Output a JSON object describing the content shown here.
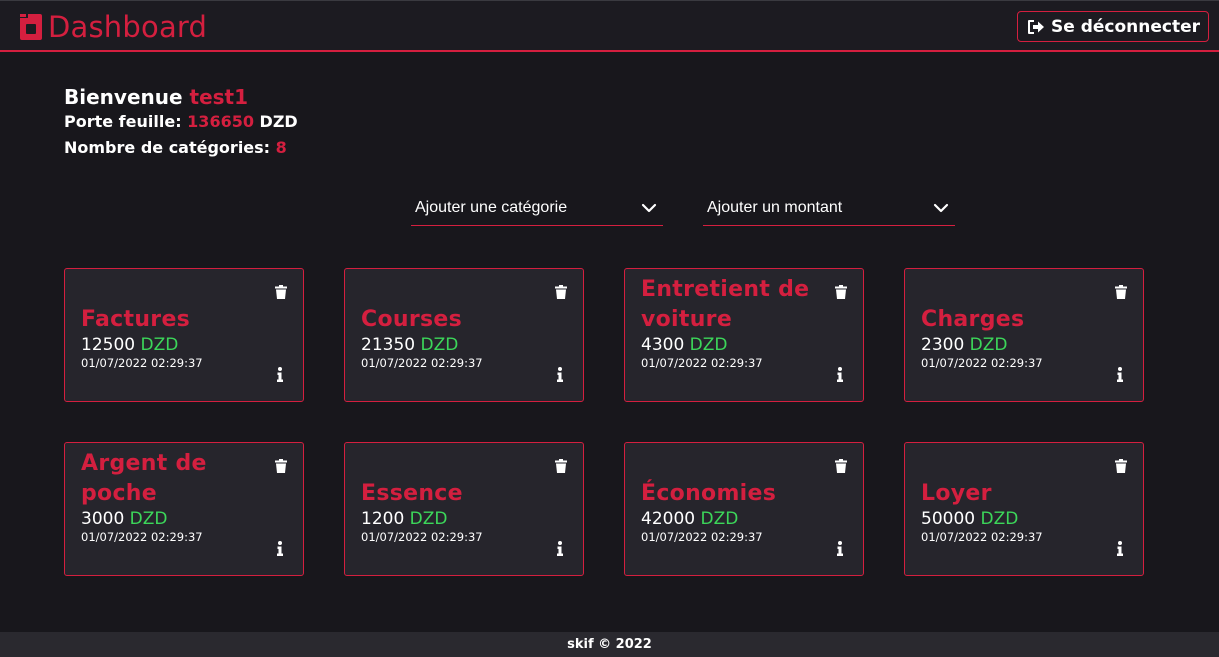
{
  "header": {
    "title": "Dashboard",
    "logout_label": "Se déconnecter",
    "logo_icon": "dashboard-logo-icon",
    "logout_icon": "sign-out-icon"
  },
  "welcome": {
    "greeting": "Bienvenue",
    "username": "test1",
    "wallet_label": "Porte feuille:",
    "wallet_value": "136650",
    "wallet_currency": "DZD",
    "categories_label": "Nombre de catégories:",
    "categories_count": "8"
  },
  "actions": {
    "add_category": "Ajouter une catégorie",
    "add_amount": "Ajouter un montant"
  },
  "cards": [
    {
      "name": "Factures",
      "amount": "12500",
      "currency": "DZD",
      "date": "01/07/2022 02:29:37"
    },
    {
      "name": "Courses",
      "amount": "21350",
      "currency": "DZD",
      "date": "01/07/2022 02:29:37"
    },
    {
      "name": "Entretient de voiture",
      "amount": "4300",
      "currency": "DZD",
      "date": "01/07/2022 02:29:37"
    },
    {
      "name": "Charges",
      "amount": "2300",
      "currency": "DZD",
      "date": "01/07/2022 02:29:37"
    },
    {
      "name": "Argent de poche",
      "amount": "3000",
      "currency": "DZD",
      "date": "01/07/2022 02:29:37"
    },
    {
      "name": "Essence",
      "amount": "1200",
      "currency": "DZD",
      "date": "01/07/2022 02:29:37"
    },
    {
      "name": "Économies",
      "amount": "42000",
      "currency": "DZD",
      "date": "01/07/2022 02:29:37"
    },
    {
      "name": "Loyer",
      "amount": "50000",
      "currency": "DZD",
      "date": "01/07/2022 02:29:37"
    }
  ],
  "footer": {
    "text": "skif © 2022"
  },
  "colors": {
    "accent": "#d41f3f",
    "currency": "#3cd65a",
    "background": "#18171c",
    "card": "#26252c"
  }
}
